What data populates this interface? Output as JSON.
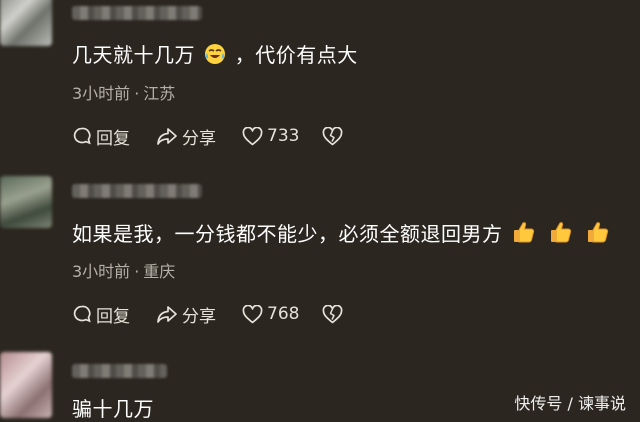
{
  "comments": [
    {
      "text": "几天就十几万",
      "text_suffix": "，代价有点大",
      "emoji": "crying-laughing-face",
      "time": "3小时前",
      "location": "江苏",
      "reply_label": "回复",
      "share_label": "分享",
      "like_count": "733"
    },
    {
      "text": "如果是我，一分钱都不能少，必须全额退回男方",
      "emoji": "thumbs-up",
      "emoji_repeat": 3,
      "time": "3小时前",
      "location": "重庆",
      "reply_label": "回复",
      "share_label": "分享",
      "like_count": "768"
    },
    {
      "text": "骗十几万"
    }
  ],
  "meta_separator": "·",
  "watermark": "快传号 / 谏事说",
  "colors": {
    "background": "#2b261f",
    "meta_text": "#b5b0a7",
    "action_text": "#e6e2da"
  }
}
